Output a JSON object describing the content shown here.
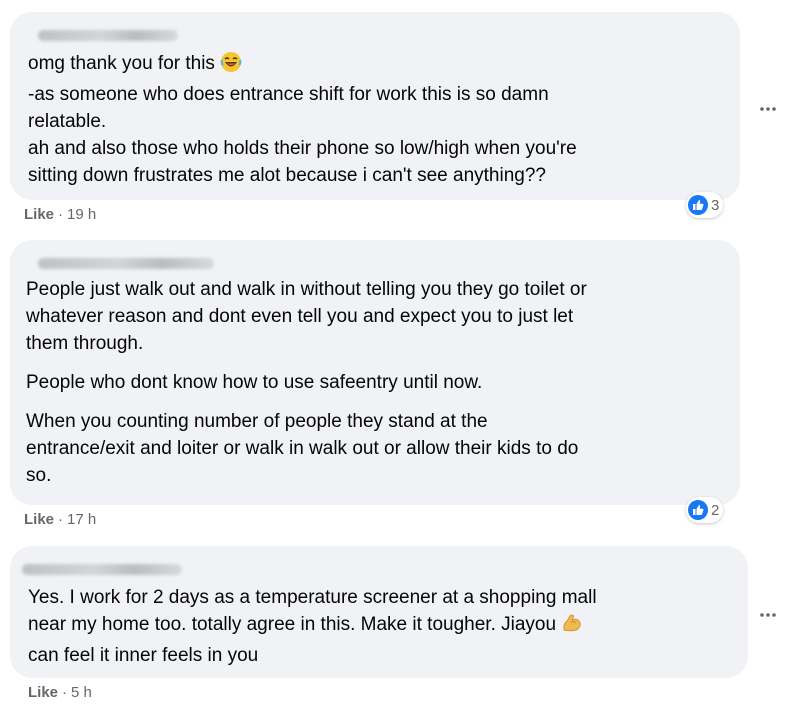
{
  "comments": [
    {
      "lines": [
        "omg thank you for this",
        "-as someone who does entrance shift for work this is so damn",
        "relatable.",
        "ah and also those who holds their phone so low/high when you're",
        "sitting down frustrates me alot because i can't see anything??"
      ],
      "emoji_icon": "laughing-emoji-icon",
      "like_label": "Like",
      "time": "19 h",
      "reaction_count": "3"
    },
    {
      "paragraphs": [
        [
          "People just walk out and walk in without telling you they go toilet or",
          "whatever reason and dont even tell you and expect you to just let",
          "them through."
        ],
        [
          "People who dont know how to use safeentry until now."
        ],
        [
          "When you counting number of people they stand at the",
          "entrance/exit and loiter or walk in walk out or allow their kids to do",
          "so."
        ]
      ],
      "like_label": "Like",
      "time": "17 h",
      "reaction_count": "2"
    },
    {
      "lines": [
        "Yes. I work for 2 days as a temperature screener at a shopping mall",
        "near my home too. totally agree in this. Make it tougher. Jiayou",
        "can feel it inner feels in you"
      ],
      "emoji_icon": "flexed-biceps-emoji-icon",
      "like_label": "Like",
      "time": "5 h"
    }
  ],
  "separator": "·",
  "icons": {
    "reaction": "like-reaction-icon",
    "more": "more-options-icon"
  },
  "colors": {
    "bubble": "#f0f2f5",
    "meta": "#65676b",
    "like_blue": "#1877f2"
  }
}
